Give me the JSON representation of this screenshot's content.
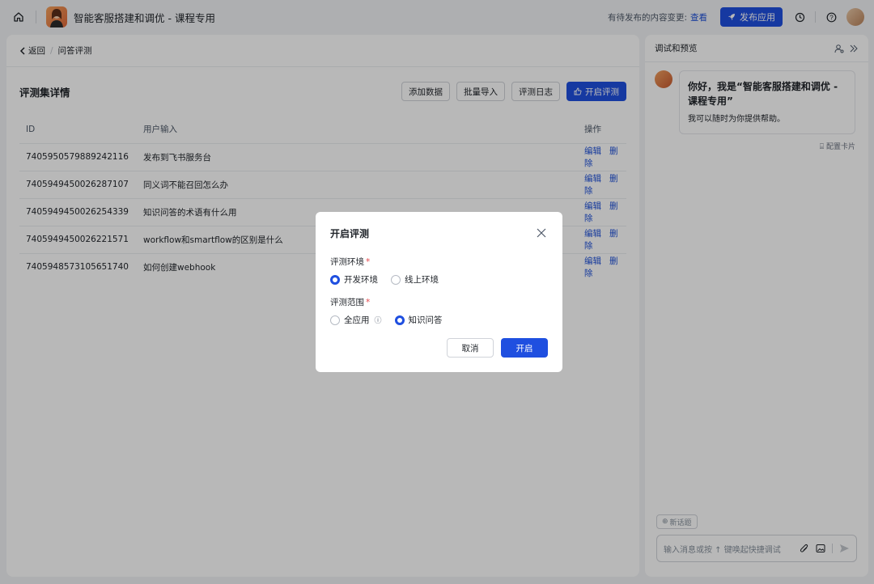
{
  "topbar": {
    "app_title": "智能客服搭建和调优 - 课程专用",
    "pending_text": "有待发布的内容变更:",
    "view_link": "查看",
    "publish_label": "发布应用"
  },
  "breadcrumb": {
    "back_label": "返回",
    "current": "问答评测"
  },
  "section": {
    "title": "评测集详情",
    "actions": {
      "add_data": "添加数据",
      "batch_import": "批量导入",
      "eval_log": "评测日志",
      "start_eval": "开启评测"
    }
  },
  "table": {
    "headers": {
      "id": "ID",
      "input": "用户输入",
      "ops": "操作"
    },
    "edit_label": "编辑",
    "delete_label": "删除",
    "rows": [
      {
        "id": "7405950579889242116",
        "input": "发布到飞书服务台"
      },
      {
        "id": "7405949450026287107",
        "input": "同义词不能召回怎么办"
      },
      {
        "id": "7405949450026254339",
        "input": "知识问答的术语有什么用"
      },
      {
        "id": "7405949450026221571",
        "input": "workflow和smartflow的区别是什么"
      },
      {
        "id": "7405948573105651740",
        "input": "如何创建webhook"
      }
    ]
  },
  "side": {
    "title": "调试和预览",
    "greeting": "你好，我是“智能客服搭建和调优 - 课程专用”",
    "greeting_sub": "我可以随时为你提供帮助。",
    "config_card": "配置卡片",
    "new_topic": "新话题",
    "input_placeholder": "输入消息或按 ↑ 键唤起快捷调试"
  },
  "modal": {
    "title": "开启评测",
    "env_label": "评测环境",
    "env_options": [
      "开发环境",
      "线上环境"
    ],
    "env_selected": "开发环境",
    "scope_label": "评测范围",
    "scope_options": [
      "全应用",
      "知识问答"
    ],
    "scope_selected": "知识问答",
    "cancel_label": "取消",
    "confirm_label": "开启"
  },
  "colors": {
    "primary": "#1f4fe0",
    "link": "#1d4fd8",
    "required": "#e5484d"
  }
}
